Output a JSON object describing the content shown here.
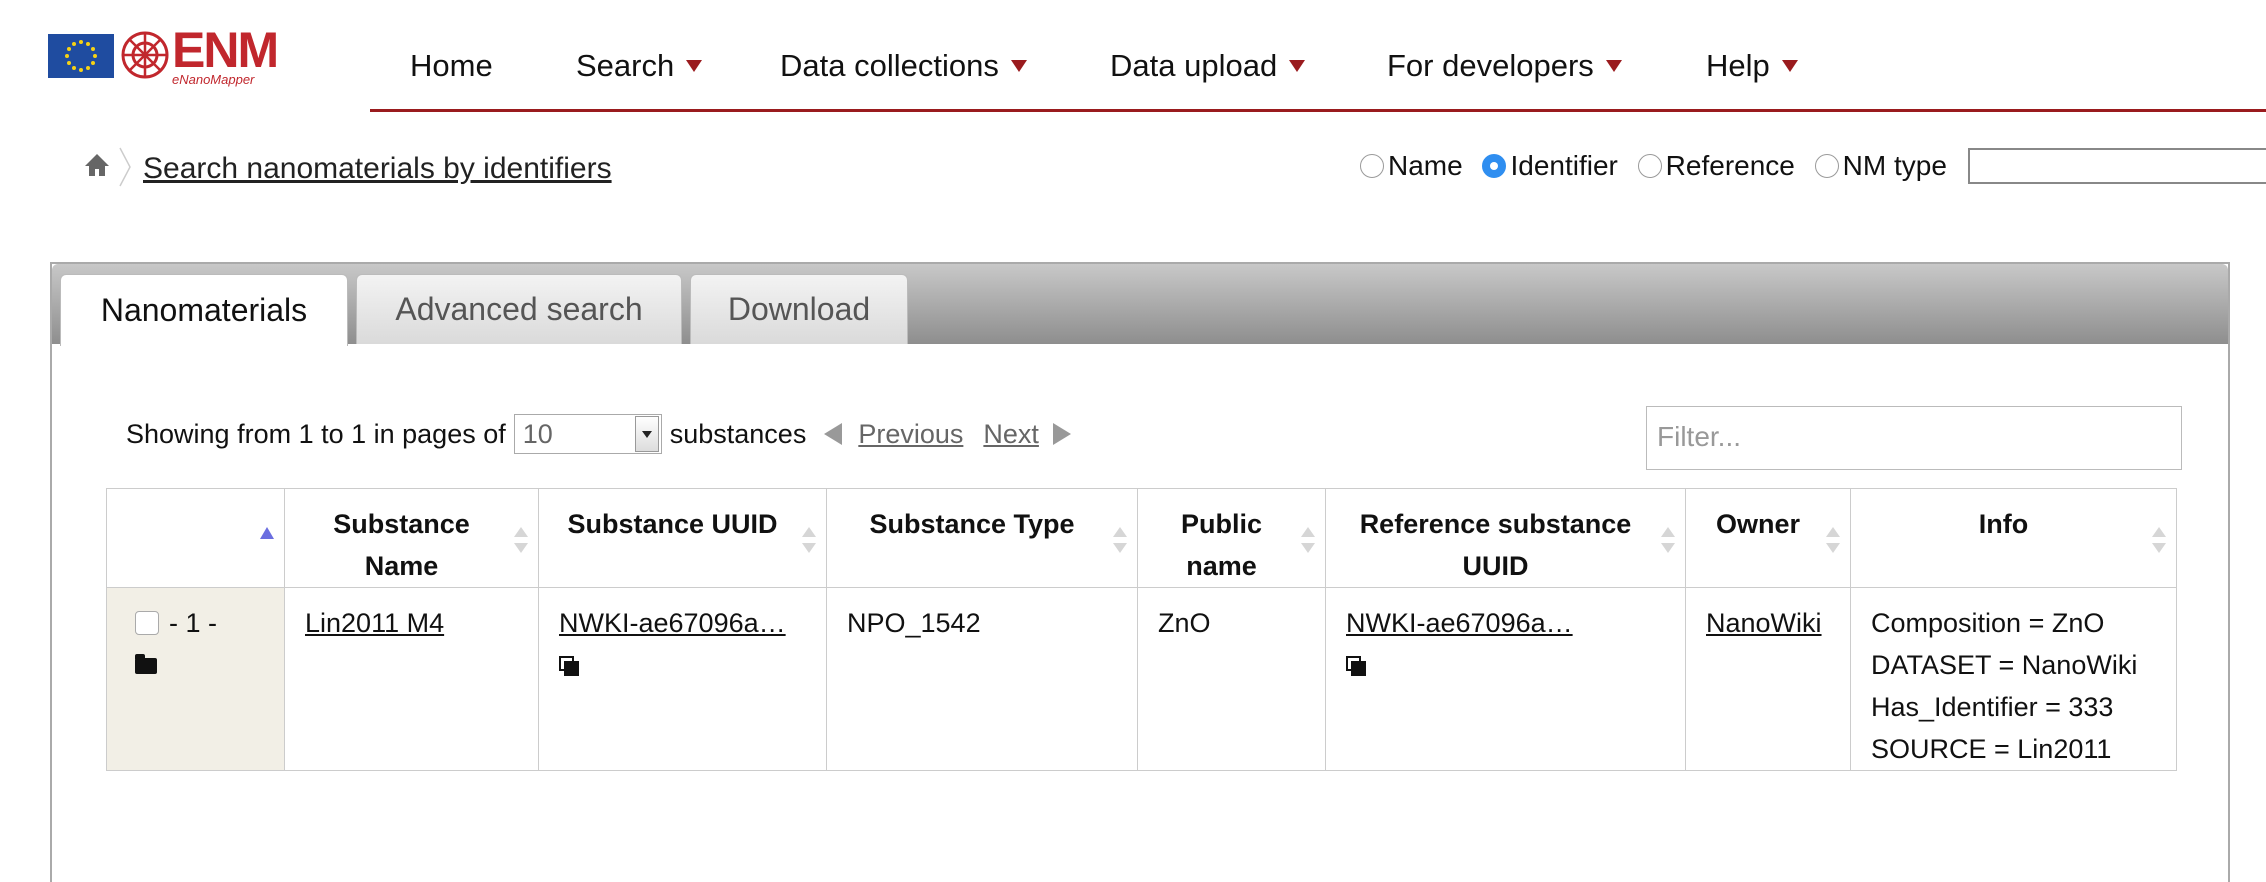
{
  "logo": {
    "wordmark": "ENM",
    "subtitle": "eNanoMapper"
  },
  "nav": {
    "items": [
      {
        "label": "Home",
        "has_menu": false
      },
      {
        "label": "Search",
        "has_menu": true
      },
      {
        "label": "Data collections",
        "has_menu": true
      },
      {
        "label": "Data upload",
        "has_menu": true
      },
      {
        "label": "For developers",
        "has_menu": true
      },
      {
        "label": "Help",
        "has_menu": true
      }
    ],
    "accent_color": "#9a1b1e"
  },
  "breadcrumb": {
    "link": "Search nanomaterials by identifiers"
  },
  "search_mode": {
    "options": [
      "Name",
      "Identifier",
      "Reference",
      "NM type"
    ],
    "selected": "Identifier",
    "query": ""
  },
  "tabs": [
    {
      "label": "Nanomaterials",
      "active": true
    },
    {
      "label": "Advanced search",
      "active": false
    },
    {
      "label": "Download",
      "active": false
    }
  ],
  "paging": {
    "prefix": "Showing from 1 to 1 in pages of",
    "page_size": "10",
    "suffix": "substances",
    "previous": "Previous",
    "next": "Next"
  },
  "filter": {
    "placeholder": "Filter..."
  },
  "table": {
    "headers": [
      "",
      "Substance Name",
      "Substance UUID",
      "Substance Type",
      "Public name",
      "Reference substance UUID",
      "Owner",
      "Info"
    ],
    "rows": [
      {
        "index": "- 1 -",
        "name": "Lin2011 M4",
        "uuid": "NWKI-ae67096a…",
        "type": "NPO_1542",
        "public_name": "ZnO",
        "ref_uuid": "NWKI-ae67096a…",
        "owner": "NanoWiki",
        "info": [
          "Composition = ZnO",
          "DATASET = NanoWiki",
          "Has_Identifier = 333",
          "SOURCE = Lin2011"
        ]
      }
    ]
  }
}
